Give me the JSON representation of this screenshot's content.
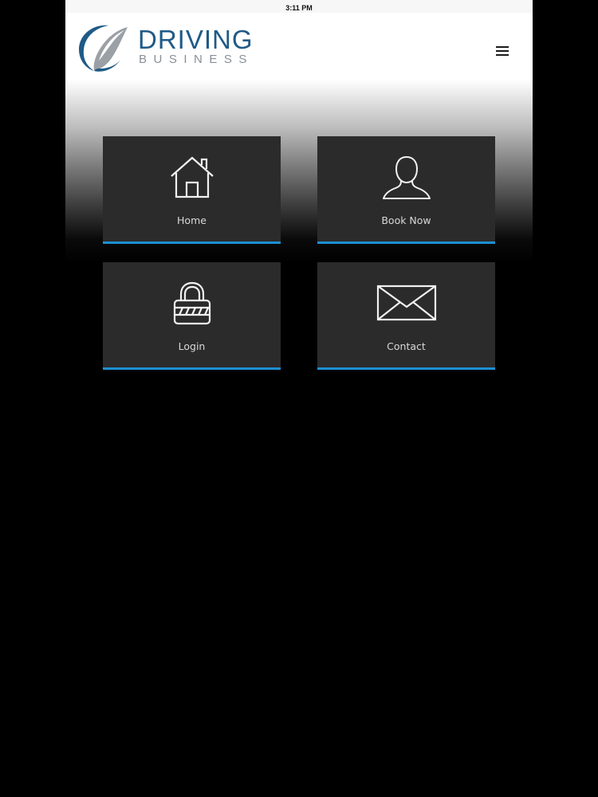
{
  "status_bar": {
    "time": "3:11 PM"
  },
  "header": {
    "logo_line1": "DRIVING",
    "logo_line2": "BUSINESS",
    "menu_icon": "hamburger-icon"
  },
  "tiles": [
    {
      "label": "Home",
      "icon": "house-icon"
    },
    {
      "label": "Book Now",
      "icon": "person-icon"
    },
    {
      "label": "Login",
      "icon": "lock-icon"
    },
    {
      "label": "Contact",
      "icon": "envelope-icon"
    }
  ],
  "colors": {
    "accent": "#1d8fd1",
    "brand_blue": "#1f5a87",
    "brand_gray": "#8a8f94",
    "tile_bg": "#2b2b2c",
    "tile_text": "#d8d8d8",
    "page_bg": "#000000"
  }
}
